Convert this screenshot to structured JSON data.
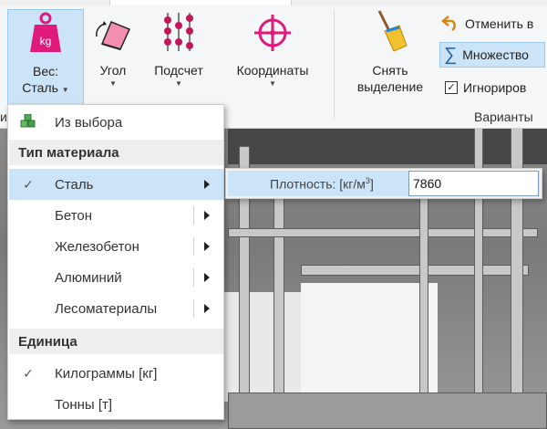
{
  "ribbon": {
    "weight": {
      "label": "Вес:",
      "sublabel": "Сталь"
    },
    "angle": {
      "label": "Угол"
    },
    "count": {
      "label": "Подсчет"
    },
    "coords": {
      "label": "Координаты"
    },
    "clear": {
      "line1": "Снять",
      "line2": "выделение"
    },
    "undo": {
      "label": "Отменить в"
    },
    "multiple": {
      "label": "Множество"
    },
    "ignore": {
      "label": "Игнориров",
      "checked": true
    },
    "group_options": "Варианты",
    "left_cut": "и"
  },
  "menu": {
    "from_selection": "Из выбора",
    "material_header": "Тип материала",
    "materials": [
      {
        "label": "Сталь",
        "checked": true
      },
      {
        "label": "Бетон",
        "checked": false
      },
      {
        "label": "Железобетон",
        "checked": false
      },
      {
        "label": "Алюминий",
        "checked": false
      },
      {
        "label": "Лесоматериалы",
        "checked": false
      }
    ],
    "unit_header": "Единица",
    "units": [
      {
        "label": "Килограммы [кг]",
        "checked": true
      },
      {
        "label": "Тонны [т]",
        "checked": false
      }
    ],
    "check_mark": "✓"
  },
  "submenu": {
    "density_label": "Плотность: [кг/м",
    "density_sup": "3",
    "density_close": "]",
    "density_value": "7860"
  },
  "colors": {
    "accent": "#cce4f7",
    "weight_icon": "#e0197d",
    "coords_icon": "#e0197d",
    "count_icon": "#c2185b"
  }
}
